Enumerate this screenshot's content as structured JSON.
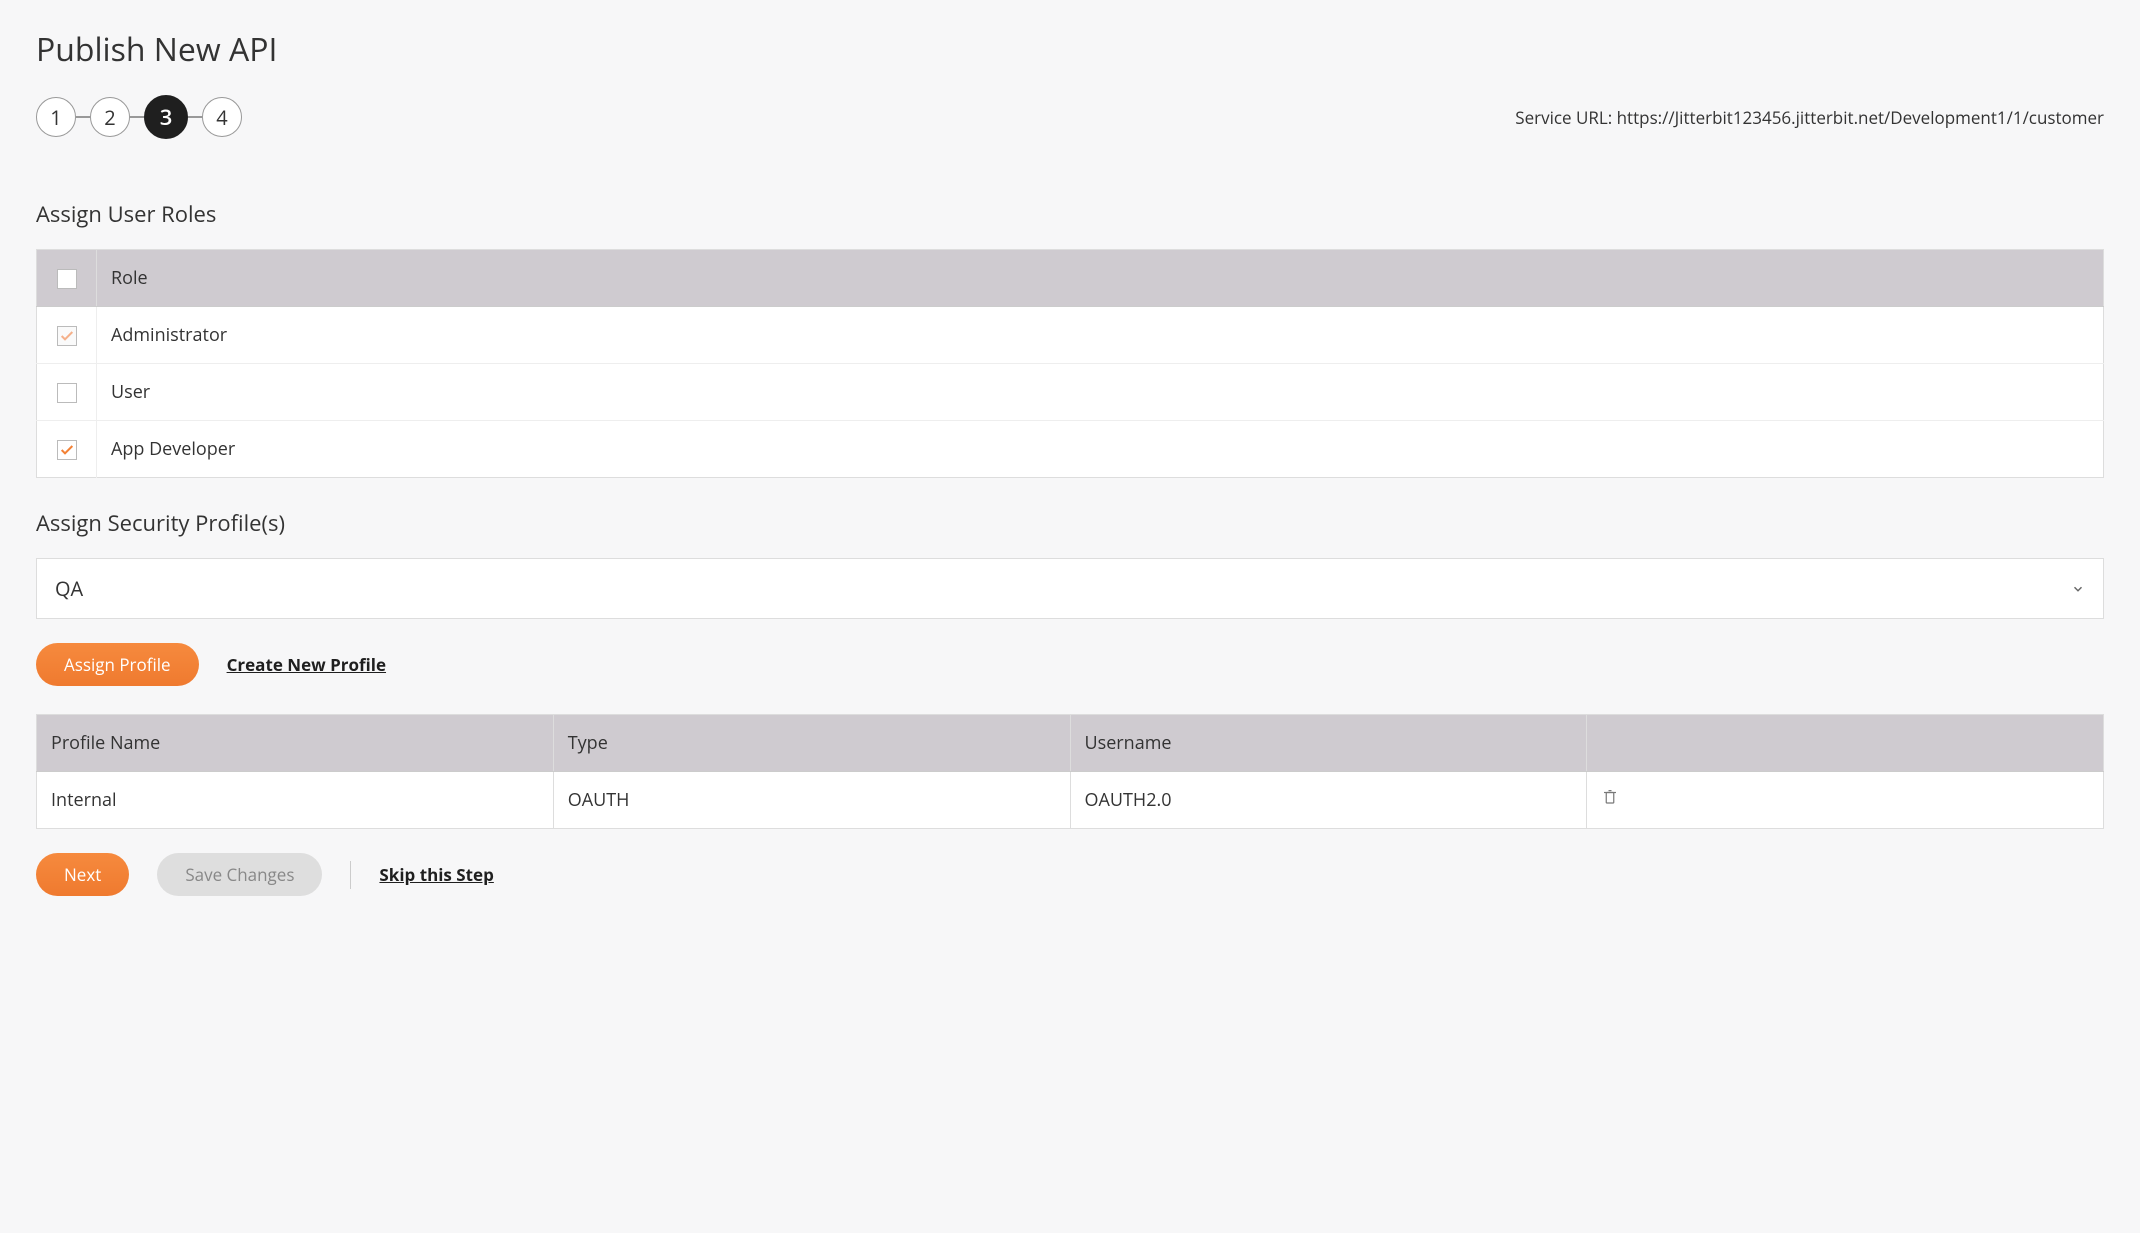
{
  "page": {
    "title": "Publish New API"
  },
  "stepper": {
    "steps": [
      "1",
      "2",
      "3",
      "4"
    ],
    "active_index": 2
  },
  "service_url": {
    "label": "Service URL: ",
    "value": "https://Jitterbit123456.jitterbit.net/Development1/1/customer"
  },
  "roles_section": {
    "heading": "Assign User Roles",
    "header_col": "Role",
    "rows": [
      {
        "label": "Administrator",
        "checked": true,
        "disabled": true
      },
      {
        "label": "User",
        "checked": false,
        "disabled": false
      },
      {
        "label": "App Developer",
        "checked": true,
        "disabled": false
      }
    ]
  },
  "profiles_section": {
    "heading": "Assign Security Profile(s)",
    "select_value": "QA",
    "assign_button": "Assign Profile",
    "create_link": "Create New Profile",
    "table": {
      "headers": {
        "name": "Profile Name",
        "type": "Type",
        "username": "Username",
        "actions": ""
      },
      "rows": [
        {
          "name": "Internal",
          "type": "OAUTH",
          "username": "OAUTH2.0"
        }
      ]
    }
  },
  "footer": {
    "next": "Next",
    "save": "Save Changes",
    "skip": "Skip this Step"
  }
}
